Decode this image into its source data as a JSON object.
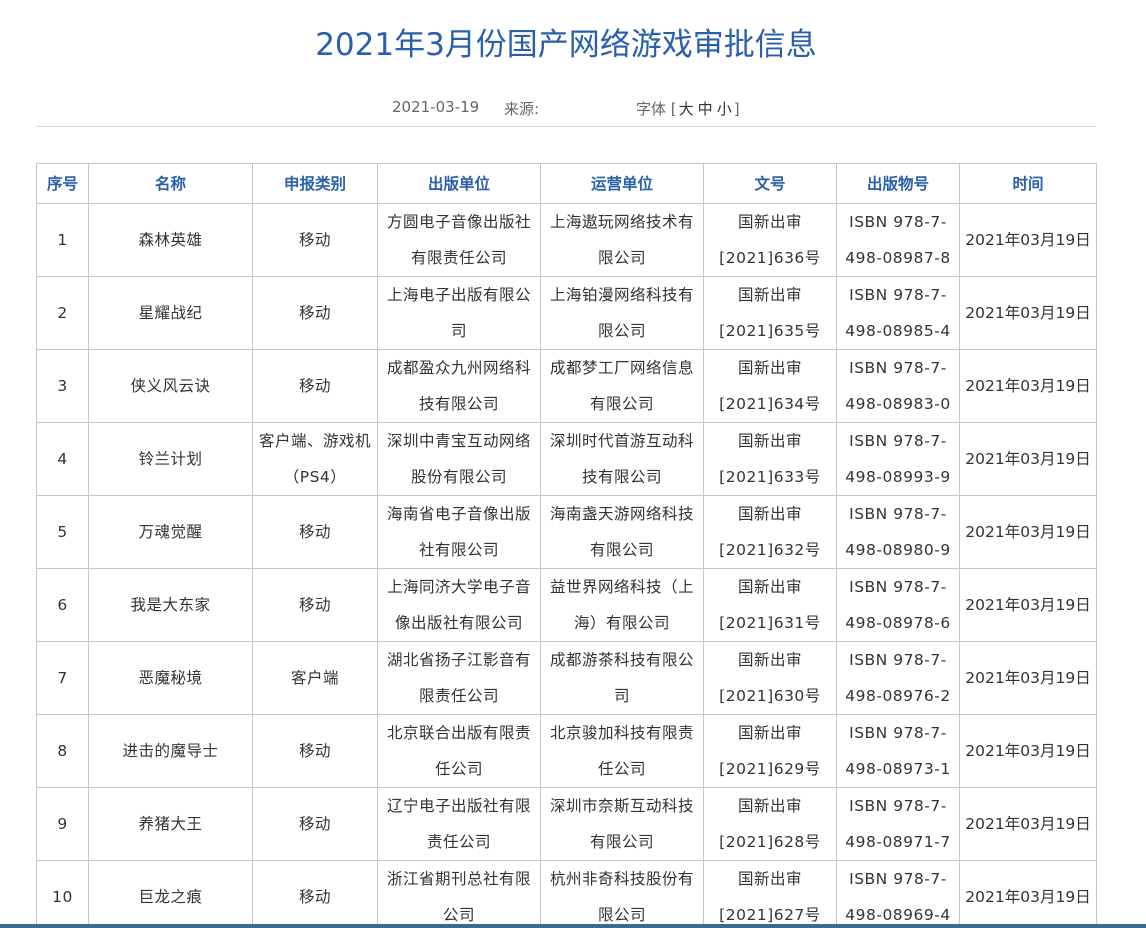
{
  "page": {
    "title": "2021年3月份国产网络游戏审批信息",
    "date": "2021-03-19",
    "source_label": "来源:",
    "font_size_label": "字体",
    "font_sizes": [
      "大",
      "中",
      "小"
    ],
    "bracket_open": "[",
    "bracket_close": "]"
  },
  "table": {
    "headers": [
      "序号",
      "名称",
      "申报类别",
      "出版单位",
      "运营单位",
      "文号",
      "出版物号",
      "时间"
    ],
    "rows": [
      [
        "1",
        "森林英雄",
        "移动",
        "方圆电子音像出版社有限责任公司",
        "上海遨玩网络技术有限公司",
        "国新出审[2021]636号",
        "ISBN 978-7-498-08987-8",
        "2021年03月19日"
      ],
      [
        "2",
        "星耀战纪",
        "移动",
        "上海电子出版有限公司",
        "上海铂漫网络科技有限公司",
        "国新出审[2021]635号",
        "ISBN 978-7-498-08985-4",
        "2021年03月19日"
      ],
      [
        "3",
        "侠义风云诀",
        "移动",
        "成都盈众九州网络科技有限公司",
        "成都梦工厂网络信息有限公司",
        "国新出审[2021]634号",
        "ISBN 978-7-498-08983-0",
        "2021年03月19日"
      ],
      [
        "4",
        "铃兰计划",
        "客户端、游戏机（PS4）",
        "深圳中青宝互动网络股份有限公司",
        "深圳时代首游互动科技有限公司",
        "国新出审[2021]633号",
        "ISBN 978-7-498-08993-9",
        "2021年03月19日"
      ],
      [
        "5",
        "万魂觉醒",
        "移动",
        "海南省电子音像出版社有限公司",
        "海南盏天游网络科技有限公司",
        "国新出审[2021]632号",
        "ISBN 978-7-498-08980-9",
        "2021年03月19日"
      ],
      [
        "6",
        "我是大东家",
        "移动",
        "上海同济大学电子音像出版社有限公司",
        "益世界网络科技（上海）有限公司",
        "国新出审[2021]631号",
        "ISBN 978-7-498-08978-6",
        "2021年03月19日"
      ],
      [
        "7",
        "恶魔秘境",
        "客户端",
        "湖北省扬子江影音有限责任公司",
        "成都游茶科技有限公司",
        "国新出审[2021]630号",
        "ISBN 978-7-498-08976-2",
        "2021年03月19日"
      ],
      [
        "8",
        "进击的魔导士",
        "移动",
        "北京联合出版有限责任公司",
        "北京骏加科技有限责任公司",
        "国新出审[2021]629号",
        "ISBN 978-7-498-08973-1",
        "2021年03月19日"
      ],
      [
        "9",
        "养猪大王",
        "移动",
        "辽宁电子出版社有限责任公司",
        "深圳市奈斯互动科技有限公司",
        "国新出审[2021]628号",
        "ISBN 978-7-498-08971-7",
        "2021年03月19日"
      ],
      [
        "10",
        "巨龙之痕",
        "移动",
        "浙江省期刊总社有限公司",
        "杭州非奇科技股份有限公司",
        "国新出审[2021]627号",
        "ISBN 978-7-498-08969-4",
        "2021年03月19日"
      ]
    ]
  },
  "colors": {
    "title": "#2a5fa9",
    "header_text": "#2a5fa9",
    "body_text": "#333333",
    "meta_text": "#666666",
    "border": "#c6c6c6"
  }
}
